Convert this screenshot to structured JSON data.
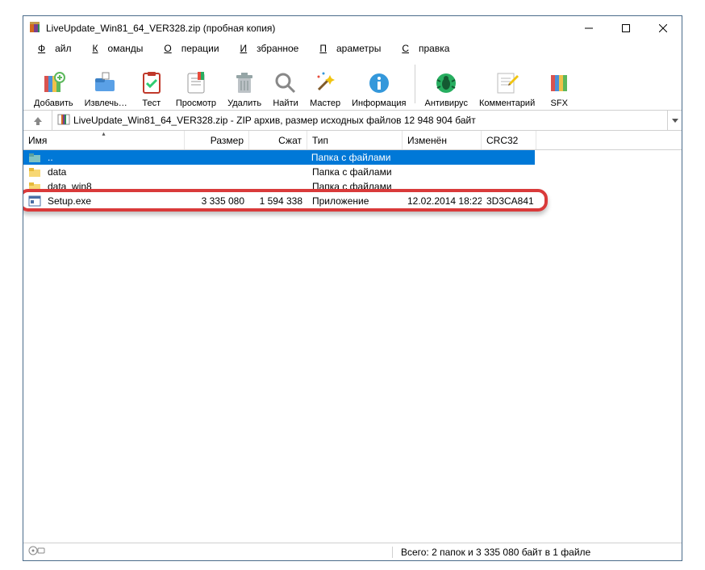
{
  "window": {
    "title": "LiveUpdate_Win81_64_VER328.zip (пробная копия)"
  },
  "menu": {
    "f1": "Ф",
    "f2": "айл",
    "c1": "К",
    "c2": "оманды",
    "o1": "О",
    "o2": "перации",
    "b1": "И",
    "b2": "збранное",
    "p1": "П",
    "p2": "араметры",
    "s1": "С",
    "s2": "правка"
  },
  "toolbar": {
    "add": "Добавить",
    "extract": "Извлечь…",
    "test": "Тест",
    "view": "Просмотр",
    "del": "Удалить",
    "find": "Найти",
    "wizard": "Мастер",
    "info": "Информация",
    "av": "Антивирус",
    "comment": "Комментарий",
    "sfx": "SFX"
  },
  "address": {
    "text": "LiveUpdate_Win81_64_VER328.zip - ZIP архив, размер исходных файлов 12 948 904 байт"
  },
  "headers": {
    "name": "Имя",
    "size": "Размер",
    "packed": "Сжат",
    "type": "Тип",
    "modified": "Изменён",
    "crc": "CRC32"
  },
  "rows": [
    {
      "icon": "up",
      "name": "..",
      "size": "",
      "packed": "",
      "type": "Папка с файлами",
      "modified": "",
      "crc": ""
    },
    {
      "icon": "folder",
      "name": "data",
      "size": "",
      "packed": "",
      "type": "Папка с файлами",
      "modified": "",
      "crc": ""
    },
    {
      "icon": "folder",
      "name": "data_win8",
      "size": "",
      "packed": "",
      "type": "Папка с файлами",
      "modified": "",
      "crc": ""
    },
    {
      "icon": "exe",
      "name": "Setup.exe",
      "size": "3 335 080",
      "packed": "1 594 338",
      "type": "Приложение",
      "modified": "12.02.2014 18:22",
      "crc": "3D3CA841"
    }
  ],
  "status": {
    "right": "Всего: 2 папок и 3 335 080 байт в 1 файле"
  }
}
